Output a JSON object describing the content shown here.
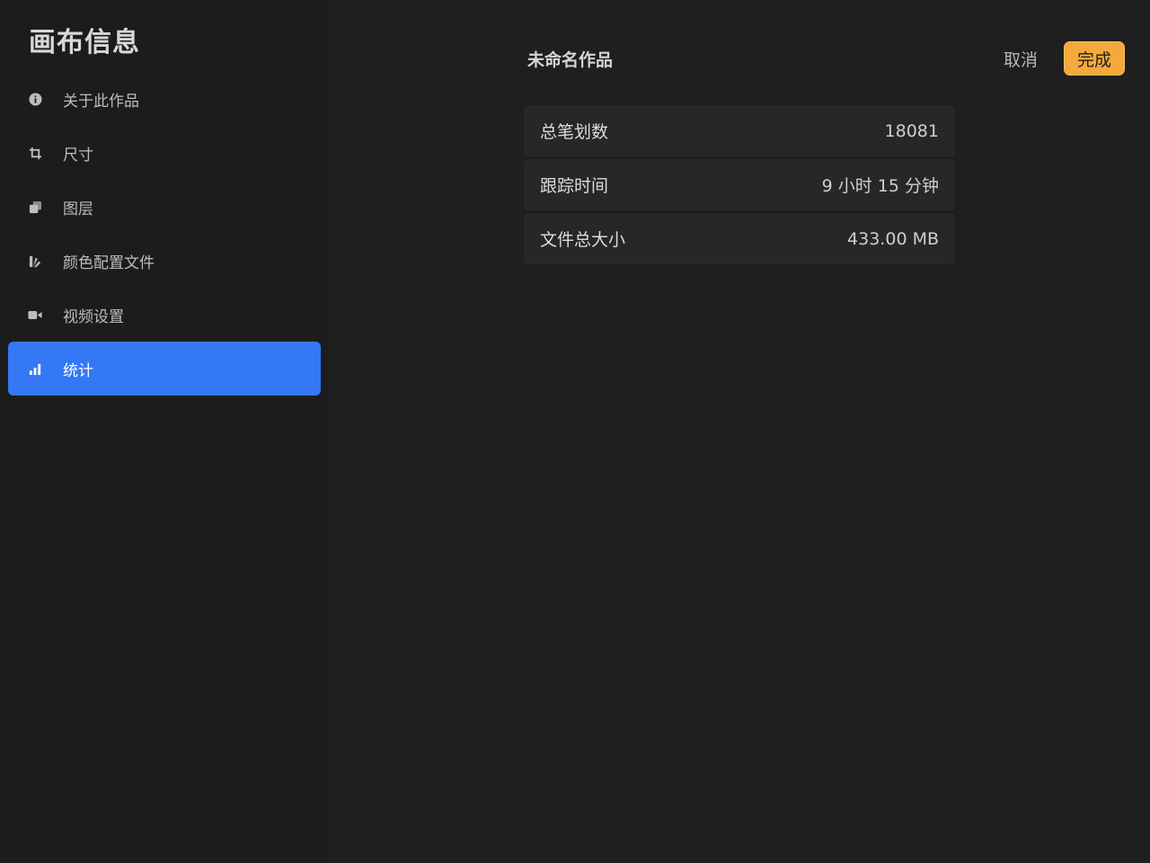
{
  "sidebar": {
    "title": "画布信息",
    "items": [
      {
        "label": "关于此作品",
        "icon": "info-icon",
        "active": false
      },
      {
        "label": "尺寸",
        "icon": "crop-icon",
        "active": false
      },
      {
        "label": "图层",
        "icon": "layers-icon",
        "active": false
      },
      {
        "label": "颜色配置文件",
        "icon": "color-profile-icon",
        "active": false
      },
      {
        "label": "视频设置",
        "icon": "video-camera-icon",
        "active": false
      },
      {
        "label": "统计",
        "icon": "bar-chart-icon",
        "active": true
      }
    ]
  },
  "header": {
    "doc_title": "未命名作品",
    "cancel_label": "取消",
    "done_label": "完成"
  },
  "stats": {
    "rows": [
      {
        "label": "总笔划数",
        "value": "18081"
      },
      {
        "label": "跟踪时间",
        "value": "9 小时 15 分钟"
      },
      {
        "label": "文件总大小",
        "value": "433.00 MB"
      }
    ]
  },
  "colors": {
    "background": "#1f1f1f",
    "sidebar_background": "#1c1c1c",
    "active_item": "#3478f6",
    "done_button": "#f5a93b",
    "row_background": "#272727"
  }
}
